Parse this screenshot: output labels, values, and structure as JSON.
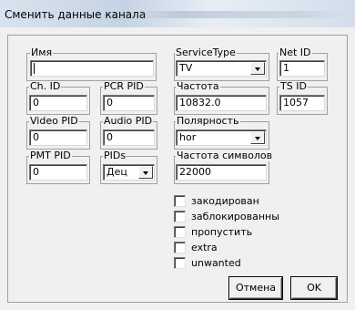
{
  "window": {
    "title": "Сменить данные канала"
  },
  "fields": {
    "name": {
      "label": "Имя",
      "value": ""
    },
    "service_type": {
      "label": "ServiceType",
      "value": "TV"
    },
    "net_id": {
      "label": "Net ID",
      "value": "1"
    },
    "ch_id": {
      "label": "Ch. ID",
      "value": "0"
    },
    "pcr_pid": {
      "label": "PCR PID",
      "value": "0"
    },
    "frequency": {
      "label": "Частота",
      "value": "10832.0"
    },
    "ts_id": {
      "label": "TS ID",
      "value": "1057"
    },
    "video_pid": {
      "label": "Video PID",
      "value": "0"
    },
    "audio_pid": {
      "label": "Audio PID",
      "value": "0"
    },
    "polarity": {
      "label": "Полярность",
      "value": "hor"
    },
    "pmt_pid": {
      "label": "PMT PID",
      "value": "0"
    },
    "pids": {
      "label": "PIDs",
      "value": "Дец"
    },
    "symbol_rate": {
      "label": "Частота символов",
      "value": "22000"
    }
  },
  "checkboxes": [
    {
      "label": "закодирован",
      "checked": false
    },
    {
      "label": "заблокированны",
      "checked": false
    },
    {
      "label": "пропустить",
      "checked": false
    },
    {
      "label": "extra",
      "checked": false
    },
    {
      "label": "unwanted",
      "checked": false
    }
  ],
  "buttons": {
    "cancel": "Отмена",
    "ok": "OK"
  }
}
